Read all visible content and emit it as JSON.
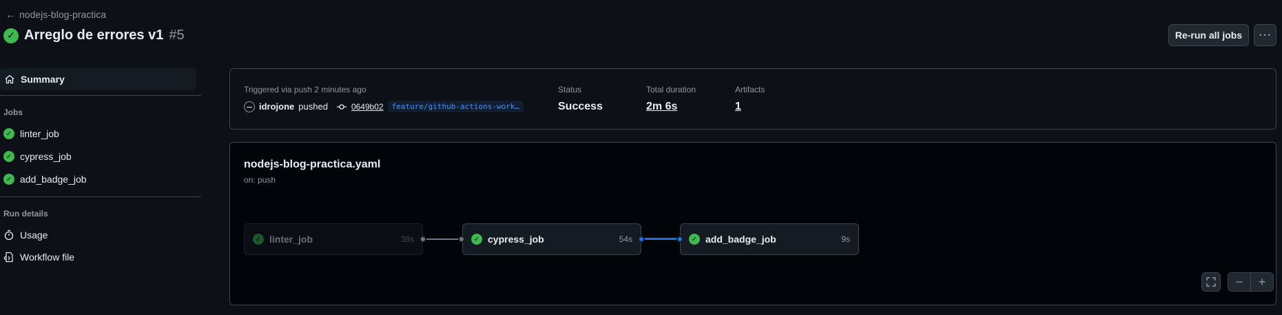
{
  "header": {
    "back_label": "nodejs-blog-practica",
    "run_title": "Arreglo de errores v1",
    "run_number": "#5",
    "rerun_label": "Re-run all jobs",
    "more_label": "···"
  },
  "sidebar": {
    "summary_label": "Summary",
    "jobs_heading": "Jobs",
    "jobs": [
      {
        "label": "linter_job",
        "status": "success"
      },
      {
        "label": "cypress_job",
        "status": "success"
      },
      {
        "label": "add_badge_job",
        "status": "success"
      }
    ],
    "run_details_heading": "Run details",
    "usage_label": "Usage",
    "workflow_file_label": "Workflow file"
  },
  "info": {
    "triggered_text": "Triggered via push 2 minutes ago",
    "user": "idrojone",
    "action": "pushed",
    "commit": "0649b02",
    "branch": "feature/github-actions-work…",
    "status_label": "Status",
    "status_value": "Success",
    "duration_label": "Total duration",
    "duration_value": "2m 6s",
    "artifacts_label": "Artifacts",
    "artifacts_value": "1"
  },
  "workflow": {
    "name": "nodejs-blog-practica.yaml",
    "trigger": "on: push",
    "jobs": [
      {
        "name": "linter_job",
        "time": "38s"
      },
      {
        "name": "cypress_job",
        "time": "54s"
      },
      {
        "name": "add_badge_job",
        "time": "9s"
      }
    ]
  },
  "colors": {
    "background": "#0d1117",
    "success": "#3fb950",
    "accent": "#1f6feb",
    "border": "#3d444d"
  },
  "icons": {
    "back": "arrow-left-icon",
    "summary": "home-icon",
    "usage": "stopwatch-icon",
    "workflow_file": "file-code-icon",
    "commit": "git-commit-icon",
    "fullscreen": "fullscreen-icon",
    "zoom_out": "minus-icon",
    "zoom_in": "plus-icon"
  }
}
